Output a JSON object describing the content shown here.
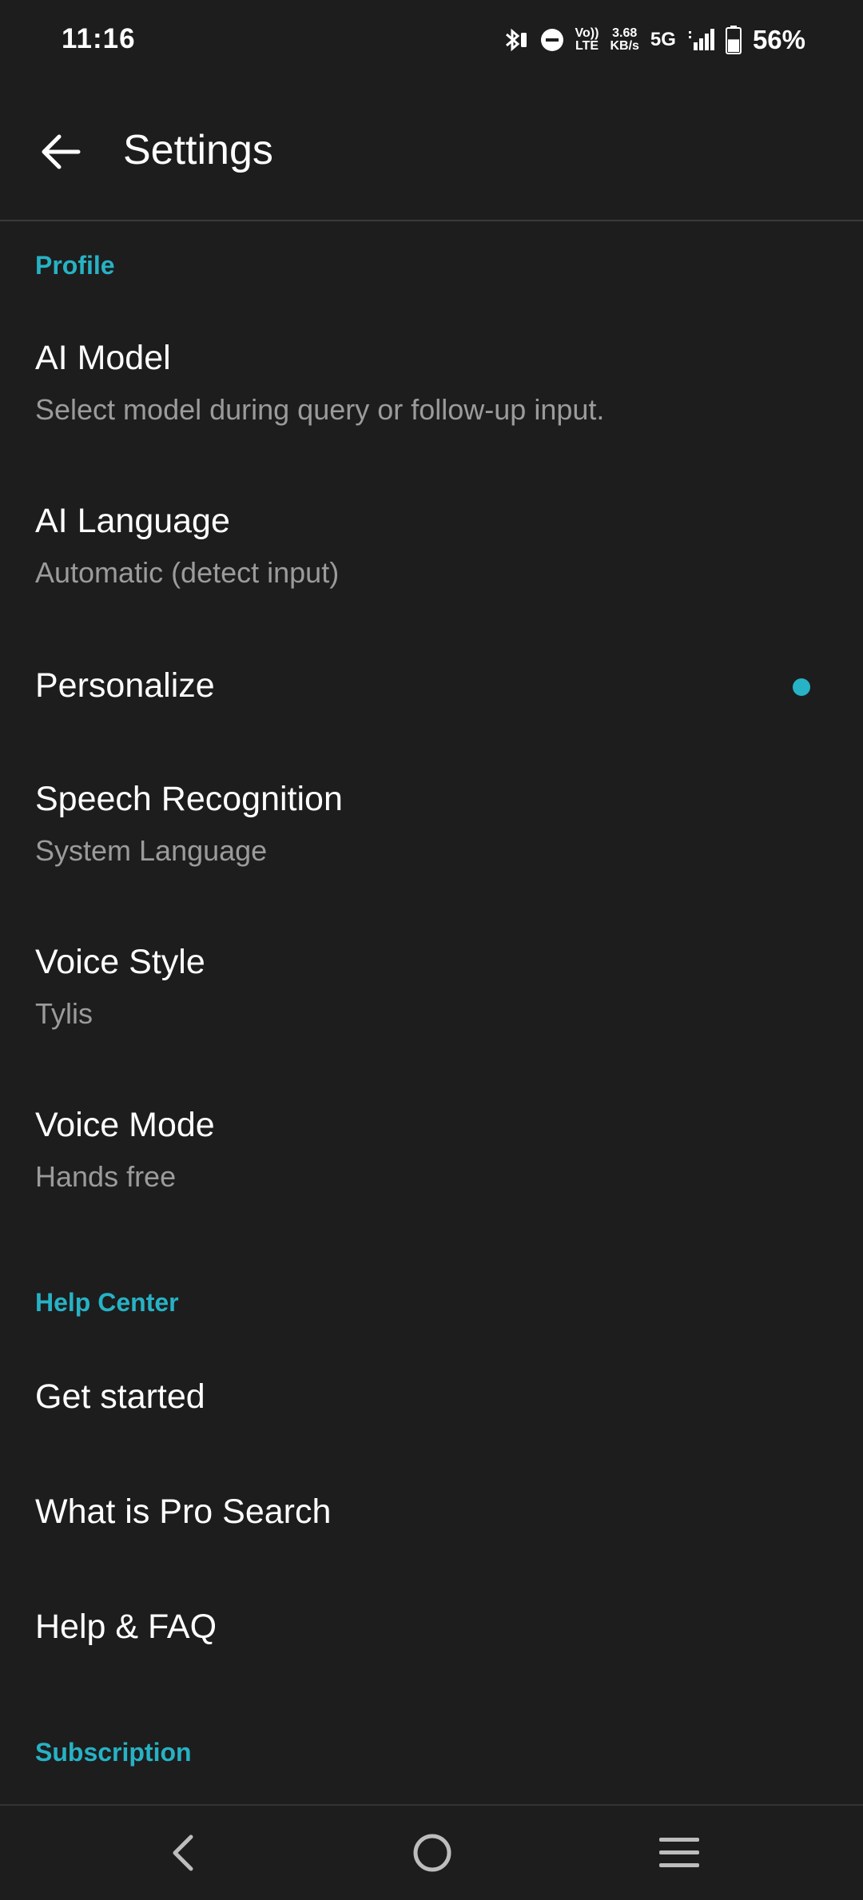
{
  "status_bar": {
    "time": "11:16",
    "volte_top": "Vo))",
    "volte_bottom": "LTE",
    "speed_value": "3.68",
    "speed_unit": "KB/s",
    "network": "5G",
    "battery": "56%",
    "battery_level": 0.56
  },
  "header": {
    "title": "Settings"
  },
  "sections": {
    "profile": "Profile",
    "help_center": "Help Center",
    "subscription": "Subscription"
  },
  "items": {
    "ai_model": {
      "title": "AI Model",
      "subtitle": "Select model during query or follow-up input."
    },
    "ai_language": {
      "title": "AI Language",
      "subtitle": "Automatic (detect input)"
    },
    "personalize": {
      "title": "Personalize"
    },
    "speech_recognition": {
      "title": "Speech Recognition",
      "subtitle": "System Language"
    },
    "voice_style": {
      "title": "Voice Style",
      "subtitle": "Tylis"
    },
    "voice_mode": {
      "title": "Voice Mode",
      "subtitle": "Hands free"
    },
    "get_started": {
      "title": "Get started"
    },
    "pro_search": {
      "title": "What is Pro Search"
    },
    "help_faq": {
      "title": "Help & FAQ"
    }
  },
  "colors": {
    "background": "#1d1d1d",
    "accent": "#27b2c5",
    "subtitle": "#9b9b9b"
  },
  "icons": {
    "back": "arrow-left-icon",
    "nav_back": "chevron-left-icon",
    "nav_home": "circle-home-icon",
    "nav_menu": "hamburger-menu-icon"
  }
}
